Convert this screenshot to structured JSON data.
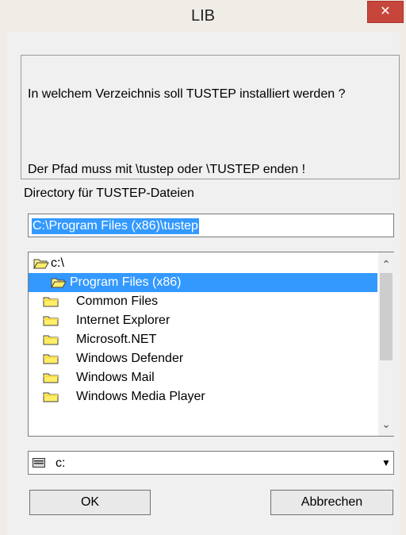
{
  "window": {
    "title": "LIB",
    "close_glyph": "✕"
  },
  "message": {
    "line1": "In welchem Verzeichnis soll TUSTEP installiert werden ?",
    "line2": "Der Pfad muss mit  \\tustep  oder  \\TUSTEP  enden !"
  },
  "directory": {
    "label": "Directory für TUSTEP-Dateien",
    "value": "C:\\Program Files (x86)\\tustep"
  },
  "folders": [
    {
      "name": "c:\\",
      "state": "open",
      "selected": false
    },
    {
      "name": "Program Files (x86)",
      "state": "open",
      "selected": true
    },
    {
      "name": "Common Files",
      "state": "closed",
      "selected": false
    },
    {
      "name": "Internet Explorer",
      "state": "closed",
      "selected": false
    },
    {
      "name": "Microsoft.NET",
      "state": "closed",
      "selected": false
    },
    {
      "name": "Windows Defender",
      "state": "closed",
      "selected": false
    },
    {
      "name": "Windows Mail",
      "state": "closed",
      "selected": false
    },
    {
      "name": "Windows Media Player",
      "state": "closed",
      "selected": false
    }
  ],
  "drive": {
    "value": "c:",
    "icon": "drive-icon"
  },
  "buttons": {
    "ok": "OK",
    "cancel": "Abbrechen"
  },
  "colors": {
    "selection": "#3399ff",
    "close": "#c7463c"
  }
}
